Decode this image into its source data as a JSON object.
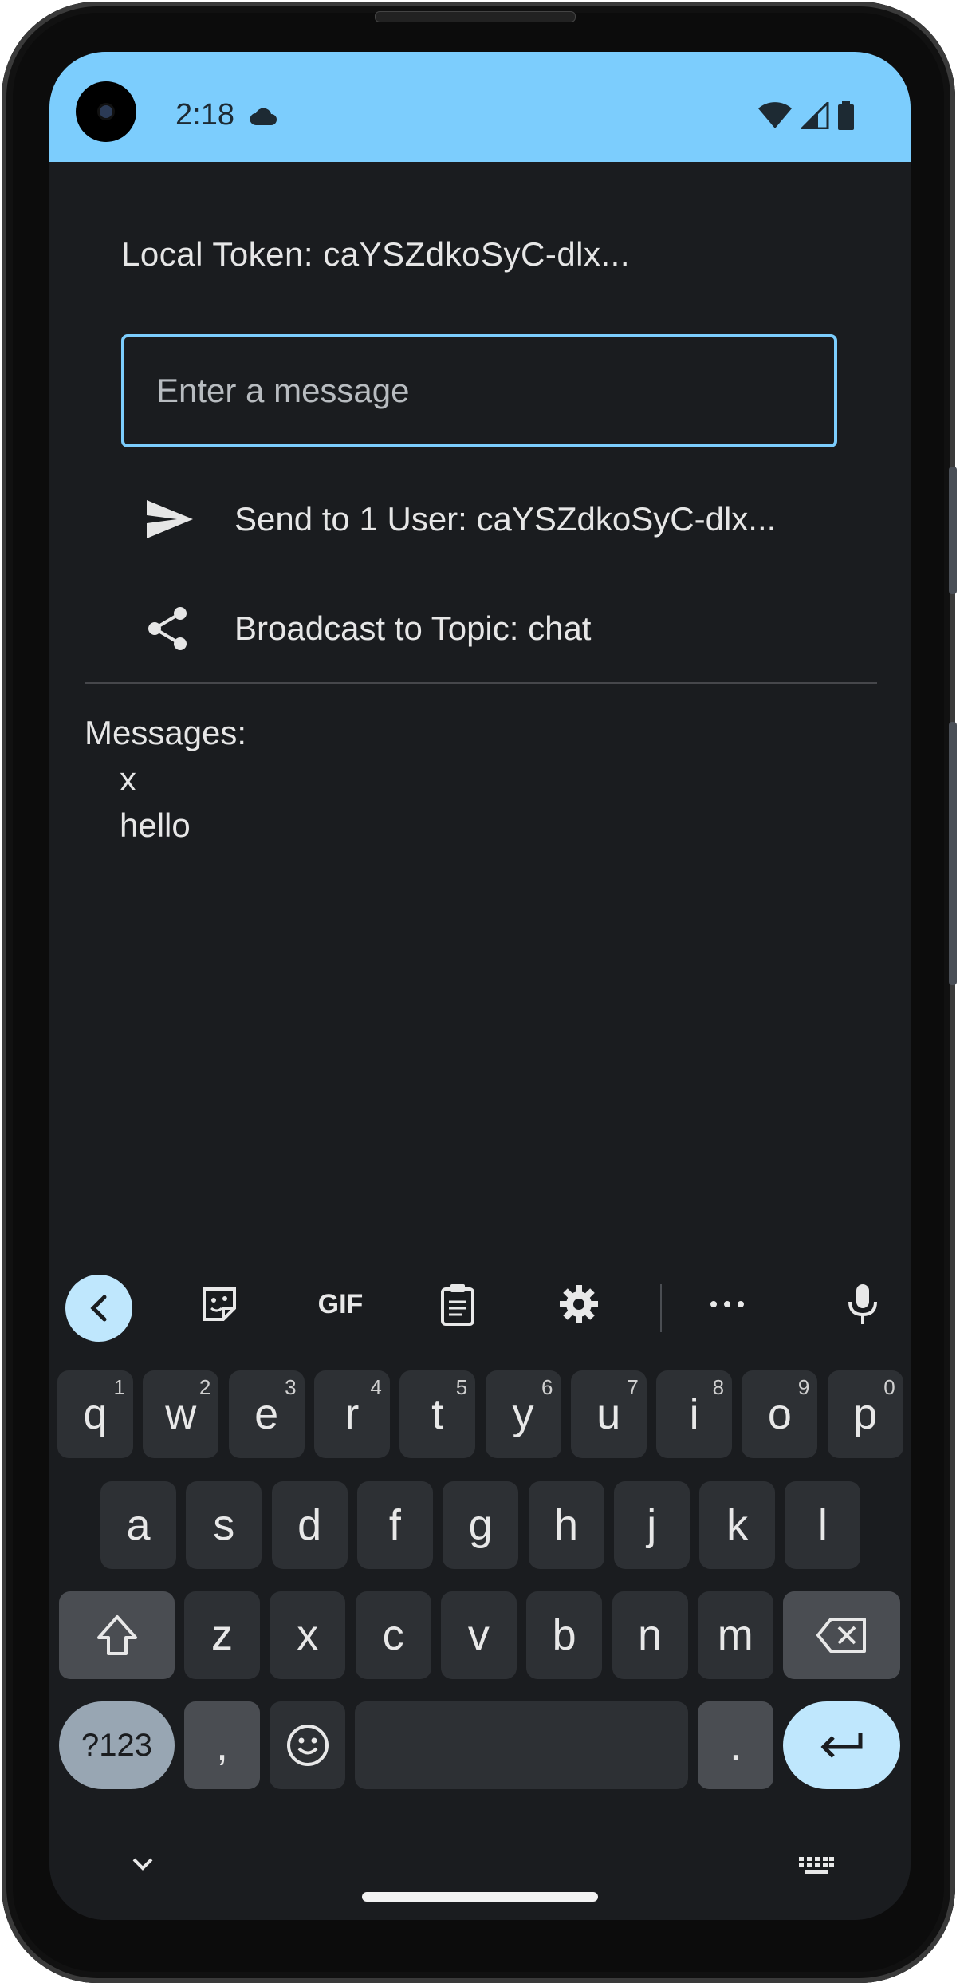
{
  "status_bar": {
    "time": "2:18"
  },
  "token": {
    "label": "Local Token: caYSZdkoSyC-dlx..."
  },
  "message_input": {
    "placeholder": "Enter a message",
    "value": ""
  },
  "actions": {
    "send_label": "Send to 1 User: caYSZdkoSyC-dlx...",
    "broadcast_label": "Broadcast to Topic: chat"
  },
  "messages": {
    "header": "Messages:",
    "items": [
      "x",
      "hello"
    ]
  },
  "keyboard": {
    "toolbar": {
      "gif_label": "GIF"
    },
    "row1": [
      {
        "key": "q",
        "hint": "1"
      },
      {
        "key": "w",
        "hint": "2"
      },
      {
        "key": "e",
        "hint": "3"
      },
      {
        "key": "r",
        "hint": "4"
      },
      {
        "key": "t",
        "hint": "5"
      },
      {
        "key": "y",
        "hint": "6"
      },
      {
        "key": "u",
        "hint": "7"
      },
      {
        "key": "i",
        "hint": "8"
      },
      {
        "key": "o",
        "hint": "9"
      },
      {
        "key": "p",
        "hint": "0"
      }
    ],
    "row2": [
      "a",
      "s",
      "d",
      "f",
      "g",
      "h",
      "j",
      "k",
      "l"
    ],
    "row3": [
      "z",
      "x",
      "c",
      "v",
      "b",
      "n",
      "m"
    ],
    "symbols_label": "?123",
    "comma": ",",
    "period": "."
  },
  "colors": {
    "accent": "#7ccdfd",
    "background": "#1a1c1f",
    "key": "#2d3034",
    "key_dark": "#4a4d52",
    "enter_key": "#bfe7fd",
    "symbols_key": "#98a6b3"
  }
}
